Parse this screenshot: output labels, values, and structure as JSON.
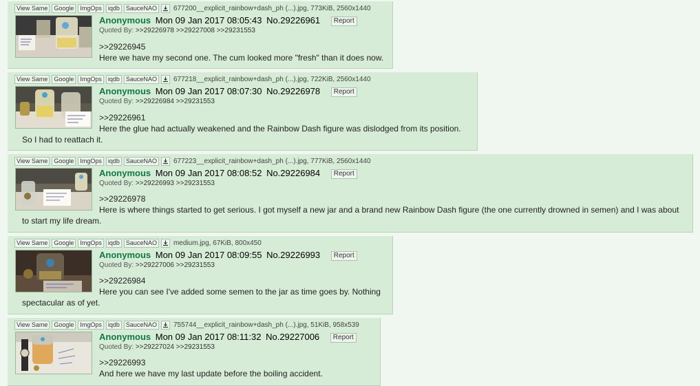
{
  "tools": {
    "view_same": "View Same",
    "google": "Google",
    "imgops": "ImgOps",
    "iqdb": "iqdb",
    "saucenao": "SauceNAO"
  },
  "posts": [
    {
      "file": "677200__explicit_rainbow+dash_ph (...).jpg, 773KiB, 2560x1440",
      "name": "Anonymous",
      "datetime": "Mon 09 Jan 2017 08:05:43",
      "no": "No.29226961",
      "reply": "Report",
      "quoted_label": "Quoted By:",
      "quoted": ">>29226978 >>29227008 >>29231553",
      "quote": ">>29226945",
      "text": "Here we have my second one. The cum looked more \"fresh\" than it does now."
    },
    {
      "file": "677218__explicit_rainbow+dash_ph (...).jpg, 722KiB, 2560x1440",
      "name": "Anonymous",
      "datetime": "Mon 09 Jan 2017 08:07:30",
      "no": "No.29226978",
      "reply": "Report",
      "quoted_label": "Quoted By:",
      "quoted": ">>29226984 >>29231553",
      "quote": ">>29226961",
      "text1": "Here the glue had actually weakened and the Rainbow Dash figure was dislodged from its position.",
      "text2": "So I had to reattach it."
    },
    {
      "file": "677223__explicit_rainbow+dash_ph (...).jpg, 777KiB, 2560x1440",
      "name": "Anonymous",
      "datetime": "Mon 09 Jan 2017 08:08:52",
      "no": "No.29226984",
      "reply": "Report",
      "quoted_label": "Quoted By:",
      "quoted": ">>29226993 >>29231553",
      "quote": ">>29226978",
      "text1": "Here is where things started to get serious. I got myself a new jar and a brand new Rainbow Dash figure (the one currently drowned in semen) and I was about",
      "text2": "to start my life dream."
    },
    {
      "file": "medium.jpg, 67KiB, 800x450",
      "name": "Anonymous",
      "datetime": "Mon 09 Jan 2017 08:09:55",
      "no": "No.29226993",
      "reply": "Report",
      "quoted_label": "Quoted By:",
      "quoted": ">>29227006 >>29231553",
      "quote": ">>29226984",
      "text1": "Here you can see I've added some semen to the jar as time goes by. Nothing",
      "text2": "spectacular as of yet."
    },
    {
      "file": "755744__explicit_rainbow+dash_ph (...).jpg, 51KiB, 958x539",
      "name": "Anonymous",
      "datetime": "Mon 09 Jan 2017 08:11:32",
      "no": "No.29227006",
      "reply": "Report",
      "quoted_label": "Quoted By:",
      "quoted": ">>29227024 >>29231553",
      "quote": ">>29226993",
      "text": "And here we have my last update before the boiling accident."
    }
  ]
}
